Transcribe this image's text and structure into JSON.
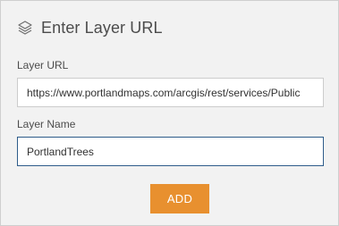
{
  "dialog": {
    "title": "Enter Layer URL",
    "icon": "layers-icon"
  },
  "layer_url": {
    "label": "Layer URL",
    "value": "https://www.portlandmaps.com/arcgis/rest/services/Public"
  },
  "layer_name": {
    "label": "Layer Name",
    "value": "PortlandTrees"
  },
  "buttons": {
    "add_label": "ADD"
  },
  "colors": {
    "accent": "#e8902f",
    "panel_background": "#f2f2f2",
    "focus_border": "#2e5c8a"
  }
}
